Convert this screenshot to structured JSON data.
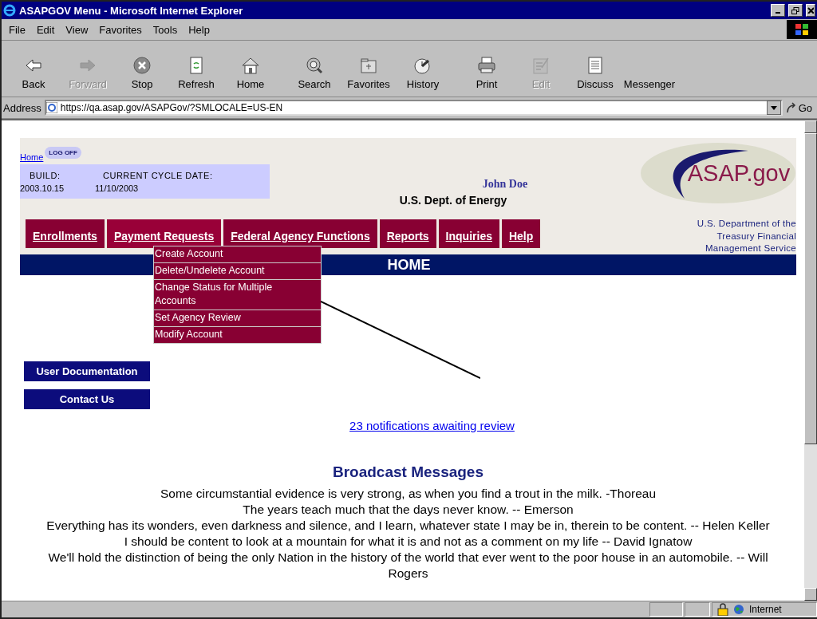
{
  "window": {
    "title": "ASAPGOV Menu - Microsoft Internet Explorer"
  },
  "menu_bar": [
    "File",
    "Edit",
    "View",
    "Favorites",
    "Tools",
    "Help"
  ],
  "toolbar": [
    {
      "label": "Back",
      "disabled": false
    },
    {
      "label": "Forward",
      "disabled": true
    },
    {
      "label": "Stop",
      "disabled": false
    },
    {
      "label": "Refresh",
      "disabled": false
    },
    {
      "label": "Home",
      "disabled": false
    },
    {
      "label": "Search",
      "disabled": false
    },
    {
      "label": "Favorites",
      "disabled": false
    },
    {
      "label": "History",
      "disabled": false
    },
    {
      "label": "Print",
      "disabled": false
    },
    {
      "label": "Edit",
      "disabled": true
    },
    {
      "label": "Discuss",
      "disabled": false
    },
    {
      "label": "Messenger",
      "disabled": false
    }
  ],
  "address_bar": {
    "label": "Address",
    "url": "https://qa.asap.gov/ASAPGov/?SMLOCALE=US-EN",
    "go": "Go"
  },
  "page": {
    "home_link": "Home",
    "log_off": "LOG OFF",
    "build": {
      "label": "BUILD:",
      "value": "2003.10.15"
    },
    "cycle_date": {
      "label": "CURRENT CYCLE DATE:",
      "value": "11/10/2003"
    },
    "user_name": "John Doe",
    "agency": "U.S. Dept. of Energy",
    "logo": "ASAP.gov",
    "treasury": "U.S. Department of the Treasury Financial Management Service",
    "nav": [
      {
        "label": "Enrollments",
        "expanded": false
      },
      {
        "label": "Payment Requests",
        "expanded": true
      },
      {
        "label": "Federal Agency Functions",
        "expanded": false
      },
      {
        "label": "Reports",
        "expanded": false
      },
      {
        "label": "Inquiries",
        "expanded": false
      },
      {
        "label": "Help",
        "expanded": false
      }
    ],
    "dropdown": [
      "Create Account",
      "Delete/Undelete Account",
      "Change Status for Multiple Accounts",
      "Set Agency Review",
      "Modify Account"
    ],
    "banner": "HOME",
    "side_buttons": [
      "User Documentation",
      "Contact Us"
    ],
    "notifications_link": "23 notifications awaiting review",
    "broadcast_title": "Broadcast Messages",
    "messages": [
      "Some circumstantial evidence is very strong, as when you find a trout in the milk. -Thoreau",
      "The years teach much that the days never know. -- Emerson",
      "Everything has its wonders, even darkness and silence, and I learn, whatever state I may be in, therein to be content. -- Helen Keller",
      "I should be content to look at a mountain for what it is and not as a comment on my life -- David Ignatow",
      "We'll hold the distinction of being the only Nation in the history of the world that ever went to the poor house in an automobile. -- Will Rogers"
    ]
  },
  "status_bar": {
    "zone": "Internet"
  }
}
